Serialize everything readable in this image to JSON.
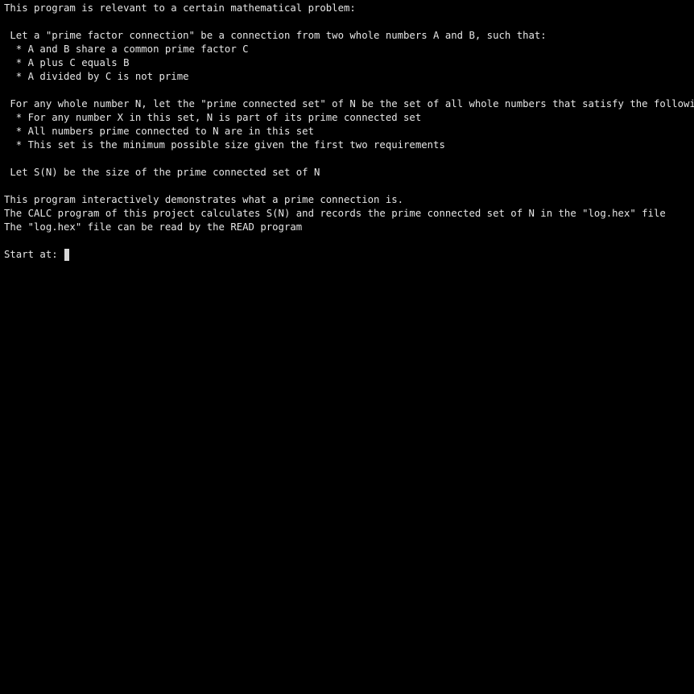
{
  "terminal": {
    "lines": [
      "This program is relevant to a certain mathematical problem:",
      "",
      " Let a \"prime factor connection\" be a connection from two whole numbers A and B, such that:",
      "  * A and B share a common prime factor C",
      "  * A plus C equals B",
      "  * A divided by C is not prime",
      "",
      " For any whole number N, let the \"prime connected set\" of N be the set of all whole numbers that satisfy the following:",
      "  * For any number X in this set, N is part of its prime connected set",
      "  * All numbers prime connected to N are in this set",
      "  * This set is the minimum possible size given the first two requirements",
      "",
      " Let S(N) be the size of the prime connected set of N",
      "",
      "This program interactively demonstrates what a prime connection is.",
      "The CALC program of this project calculates S(N) and records the prime connected set of N in the \"log.hex\" file",
      "The \"log.hex\" file can be read by the READ program",
      ""
    ],
    "prompt_label": "Start at: ",
    "input_value": ""
  },
  "colors": {
    "background": "#000000",
    "text": "#e6e6e6",
    "cursor": "#d8d8d8"
  }
}
